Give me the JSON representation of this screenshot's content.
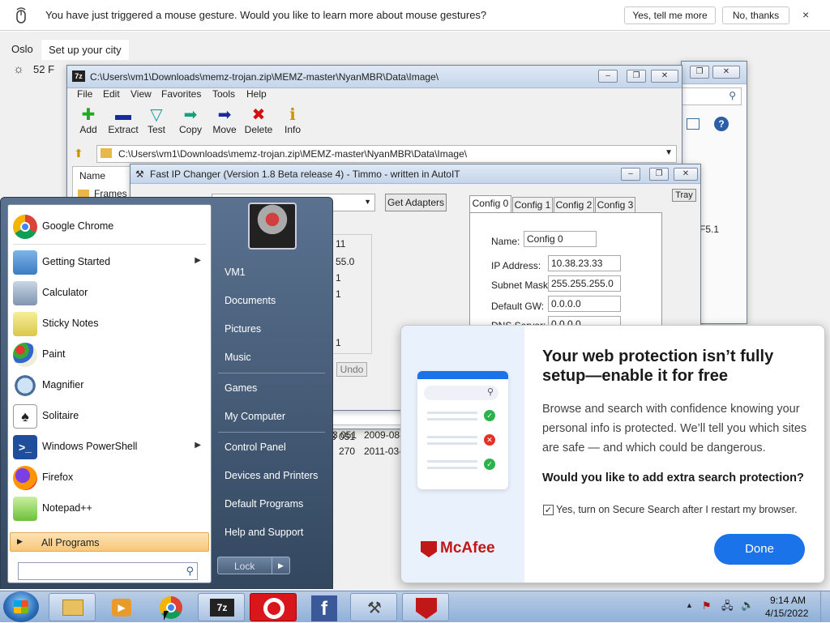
{
  "notification": {
    "message": "You have just triggered a mouse gesture. Would you like to learn more about mouse gestures?",
    "yes_label": "Yes, tell me more",
    "no_label": "No, thanks",
    "close_label": "×"
  },
  "weather": {
    "city": "Oslo",
    "setup_label": "Set up your city",
    "temp": "52 F"
  },
  "sevenzip": {
    "title": "C:\\Users\\vm1\\Downloads\\memz-trojan.zip\\MEMZ-master\\NyanMBR\\Data\\Image\\",
    "menu": [
      "File",
      "Edit",
      "View",
      "Favorites",
      "Tools",
      "Help"
    ],
    "tools": [
      {
        "label": "Add",
        "icon": "plus-icon",
        "color": "#1faa1f"
      },
      {
        "label": "Extract",
        "icon": "minus-icon",
        "color": "#1a2a9a"
      },
      {
        "label": "Test",
        "icon": "check-icon",
        "color": "#18a0a0"
      },
      {
        "label": "Copy",
        "icon": "arrow-right-icon",
        "color": "#18a07a"
      },
      {
        "label": "Move",
        "icon": "arrow-right-icon",
        "color": "#1a2a9a"
      },
      {
        "label": "Delete",
        "icon": "x-icon",
        "color": "#d01010"
      },
      {
        "label": "Info",
        "icon": "info-icon",
        "color": "#c89600"
      }
    ],
    "address": "C:\\Users\\vm1\\Downloads\\memz-trojan.zip\\MEMZ-master\\NyanMBR\\Data\\Image\\",
    "col_name": "Name",
    "rows": [
      {
        "name": "Frames"
      }
    ],
    "visible_cells": [
      {
        "size": "3 051",
        "date": "2009-08-"
      },
      {
        "size": "270",
        "date": "2011-03-"
      }
    ]
  },
  "bgwindow": {
    "label": "F5.1"
  },
  "ipchanger": {
    "title": "Fast IP Changer (Version 1.8 Beta release 4) - Timmo - written in AutoIT",
    "get_adapters": "Get Adapters",
    "tray": "Tray",
    "tabs": [
      "Config 0",
      "Config 1",
      "Config 2",
      "Config 3"
    ],
    "name_label": "Name:",
    "name_value": "Config 0",
    "ip_label": "IP Address:",
    "ip_value": "10.38.23.33",
    "mask_label": "Subnet Mask:",
    "mask_value": "255.255.255.0",
    "gw_label": "Default GW:",
    "gw_value": "0.0.0.0",
    "dns_label": "DNS Server:",
    "dns_value": "0.0.0.0",
    "undo": "Undo",
    "partial_values": [
      "11",
      "55.0",
      "1",
      "1",
      "1"
    ]
  },
  "startmenu": {
    "programs": [
      {
        "label": "Google Chrome",
        "icon": "chrome-icon",
        "arrow": false
      },
      {
        "label": "Getting Started",
        "icon": "getting-started-icon",
        "arrow": true
      },
      {
        "label": "Calculator",
        "icon": "calculator-icon",
        "arrow": false
      },
      {
        "label": "Sticky Notes",
        "icon": "sticky-notes-icon",
        "arrow": false
      },
      {
        "label": "Paint",
        "icon": "paint-icon",
        "arrow": false
      },
      {
        "label": "Magnifier",
        "icon": "magnifier-icon",
        "arrow": false
      },
      {
        "label": "Solitaire",
        "icon": "solitaire-icon",
        "arrow": false
      },
      {
        "label": "Windows PowerShell",
        "icon": "powershell-icon",
        "arrow": true
      },
      {
        "label": "Firefox",
        "icon": "firefox-icon",
        "arrow": false
      },
      {
        "label": "Notepad++",
        "icon": "notepadpp-icon",
        "arrow": false
      }
    ],
    "all_programs": "All Programs",
    "right_items": [
      "VM1",
      "Documents",
      "Pictures",
      "Music",
      "Games",
      "My Computer",
      "Control Panel",
      "Devices and Printers",
      "Default Programs",
      "Help and Support"
    ],
    "lock_label": "Lock"
  },
  "mcafee": {
    "heading": "Your web protection isn’t fully setup—enable it for free",
    "body": "Browse and search with confidence knowing your personal info is protected. We’ll tell you which sites are safe — and which could be dangerous.",
    "question": "Would you like to add extra search protection?",
    "checkbox_label": "Yes, turn on Secure Search after I restart my browser.",
    "done_label": "Done",
    "brand": "McAfee",
    "brand_color": "#c01818",
    "accent": "#1a73e8"
  },
  "taskbar": {
    "time": "9:14 AM",
    "date": "4/15/2022",
    "buttons": [
      "explorer-icon",
      "media-player-icon",
      "chrome-icon",
      "7zip-icon",
      "opera-icon",
      "facebook-icon",
      "ip-changer-icon",
      "mcafee-icon"
    ]
  }
}
